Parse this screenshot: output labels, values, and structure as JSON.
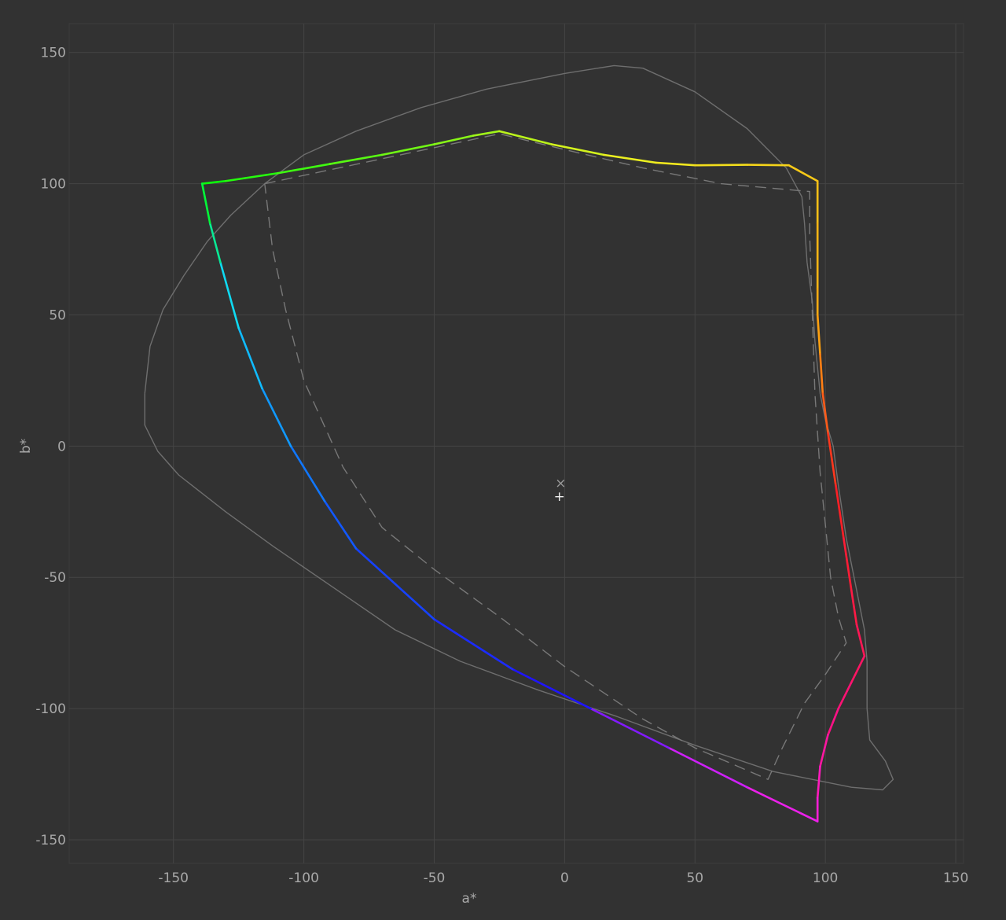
{
  "chart_data": {
    "type": "line",
    "title": "",
    "xlabel": "a*",
    "ylabel": "b*",
    "xlim": [
      -190,
      153
    ],
    "ylim": [
      -159,
      161
    ],
    "x_ticks": [
      -150,
      -100,
      -50,
      0,
      50,
      100,
      150
    ],
    "y_ticks": [
      -150,
      -100,
      -50,
      0,
      50,
      100,
      150
    ],
    "grid": true,
    "colors": {
      "background": "#323232",
      "grid": "#444444",
      "reference": "#6e6e6e",
      "tick_text": "#a8a8a8"
    },
    "series": [
      {
        "style": "solid-gray-outline",
        "points": [
          [
            -161,
            20
          ],
          [
            -159,
            38
          ],
          [
            -154,
            52
          ],
          [
            -146,
            65
          ],
          [
            -137,
            78
          ],
          [
            -128,
            88
          ],
          [
            -115,
            100
          ],
          [
            -100,
            111
          ],
          [
            -80,
            120
          ],
          [
            -55,
            129
          ],
          [
            -30,
            136
          ],
          [
            0,
            142
          ],
          [
            19,
            145
          ],
          [
            30,
            144
          ],
          [
            50,
            135
          ],
          [
            70,
            121
          ],
          [
            85,
            106
          ],
          [
            91,
            95
          ],
          [
            92,
            85
          ],
          [
            93,
            70
          ],
          [
            95,
            55
          ],
          [
            96,
            40
          ],
          [
            97,
            30
          ],
          [
            98,
            20
          ],
          [
            100,
            10
          ],
          [
            103,
            0
          ],
          [
            105,
            -15
          ],
          [
            108,
            -35
          ],
          [
            112,
            -55
          ],
          [
            115,
            -70
          ],
          [
            116,
            -82
          ],
          [
            116,
            -100
          ],
          [
            117,
            -112
          ],
          [
            123,
            -120
          ],
          [
            126,
            -127
          ],
          [
            122,
            -131
          ],
          [
            110,
            -130
          ],
          [
            80,
            -124
          ],
          [
            50,
            -114
          ],
          [
            20,
            -103
          ],
          [
            -10,
            -93
          ],
          [
            -40,
            -82
          ],
          [
            -65,
            -70
          ],
          [
            -90,
            -53
          ],
          [
            -112,
            -38
          ],
          [
            -130,
            -25
          ],
          [
            -148,
            -11
          ],
          [
            -156,
            -2
          ],
          [
            -161,
            8
          ],
          [
            -161,
            20
          ]
        ]
      },
      {
        "style": "dashed-gray",
        "points": [
          [
            -115,
            100
          ],
          [
            -25,
            119
          ],
          [
            0,
            113
          ],
          [
            30,
            106
          ],
          [
            60,
            100
          ],
          [
            94,
            97
          ],
          [
            94,
            80
          ],
          [
            95,
            50
          ],
          [
            96,
            20
          ],
          [
            98,
            -10
          ],
          [
            100,
            -30
          ],
          [
            102,
            -50
          ],
          [
            105,
            -65
          ],
          [
            108,
            -75
          ],
          [
            100,
            -87
          ],
          [
            92,
            -98
          ],
          [
            87,
            -108
          ],
          [
            83,
            -116
          ],
          [
            78,
            -127
          ],
          [
            50,
            -115
          ],
          [
            30,
            -104
          ],
          [
            0,
            -84
          ],
          [
            -25,
            -65
          ],
          [
            -50,
            -47
          ],
          [
            -70,
            -31
          ],
          [
            -85,
            -8
          ],
          [
            -100,
            25
          ],
          [
            -107,
            52
          ],
          [
            -112,
            75
          ],
          [
            -115,
            100
          ]
        ]
      },
      {
        "style": "gamut-colored",
        "points": [
          [
            -139,
            100
          ],
          [
            -130,
            101
          ],
          [
            -110,
            104
          ],
          [
            -90,
            107.5
          ],
          [
            -70,
            111
          ],
          [
            -50,
            115
          ],
          [
            -35,
            118.3
          ],
          [
            -25,
            120
          ],
          [
            -5,
            115
          ],
          [
            15,
            111
          ],
          [
            35,
            108
          ],
          [
            50,
            107
          ],
          [
            70,
            107.2
          ],
          [
            86,
            107
          ],
          [
            97,
            101
          ],
          [
            97,
            85
          ],
          [
            97,
            60
          ],
          [
            97,
            50
          ],
          [
            98,
            35
          ],
          [
            99,
            20
          ],
          [
            101,
            5
          ],
          [
            104,
            -15
          ],
          [
            107,
            -35
          ],
          [
            110,
            -55
          ],
          [
            112,
            -68
          ],
          [
            115,
            -80
          ],
          [
            110,
            -90
          ],
          [
            105,
            -100
          ],
          [
            101,
            -110
          ],
          [
            98,
            -122
          ],
          [
            97,
            -134
          ],
          [
            97,
            -143
          ],
          [
            70,
            -130
          ],
          [
            40,
            -115
          ],
          [
            10,
            -100
          ],
          [
            -20,
            -85
          ],
          [
            -50,
            -66
          ],
          [
            -80,
            -39
          ],
          [
            -92,
            -21
          ],
          [
            -105,
            0
          ],
          [
            -116,
            22
          ],
          [
            -125,
            45
          ],
          [
            -132,
            70
          ],
          [
            -136,
            85
          ],
          [
            -139,
            100
          ]
        ],
        "stops": [
          {
            "t": 0.0,
            "color": "#00ff0a"
          },
          {
            "t": 0.22,
            "color": "#f0f020"
          },
          {
            "t": 0.4,
            "color": "#ffa010"
          },
          {
            "t": 0.48,
            "color": "#ff2020"
          },
          {
            "t": 0.62,
            "color": "#ff1080"
          },
          {
            "t": 0.7,
            "color": "#ff20e0"
          },
          {
            "t": 0.75,
            "color": "#c020ff"
          },
          {
            "t": 0.78,
            "color": "#2010ff"
          },
          {
            "t": 0.86,
            "color": "#1060ff"
          },
          {
            "t": 0.94,
            "color": "#10d8ff"
          },
          {
            "t": 1.0,
            "color": "#00ff0a"
          }
        ]
      }
    ],
    "markers": [
      {
        "symbol": "×",
        "x": -1.5,
        "y": -14,
        "color": "#9a9a9a"
      },
      {
        "symbol": "+",
        "x": -2,
        "y": -19,
        "color": "#f0f0f0"
      }
    ]
  }
}
